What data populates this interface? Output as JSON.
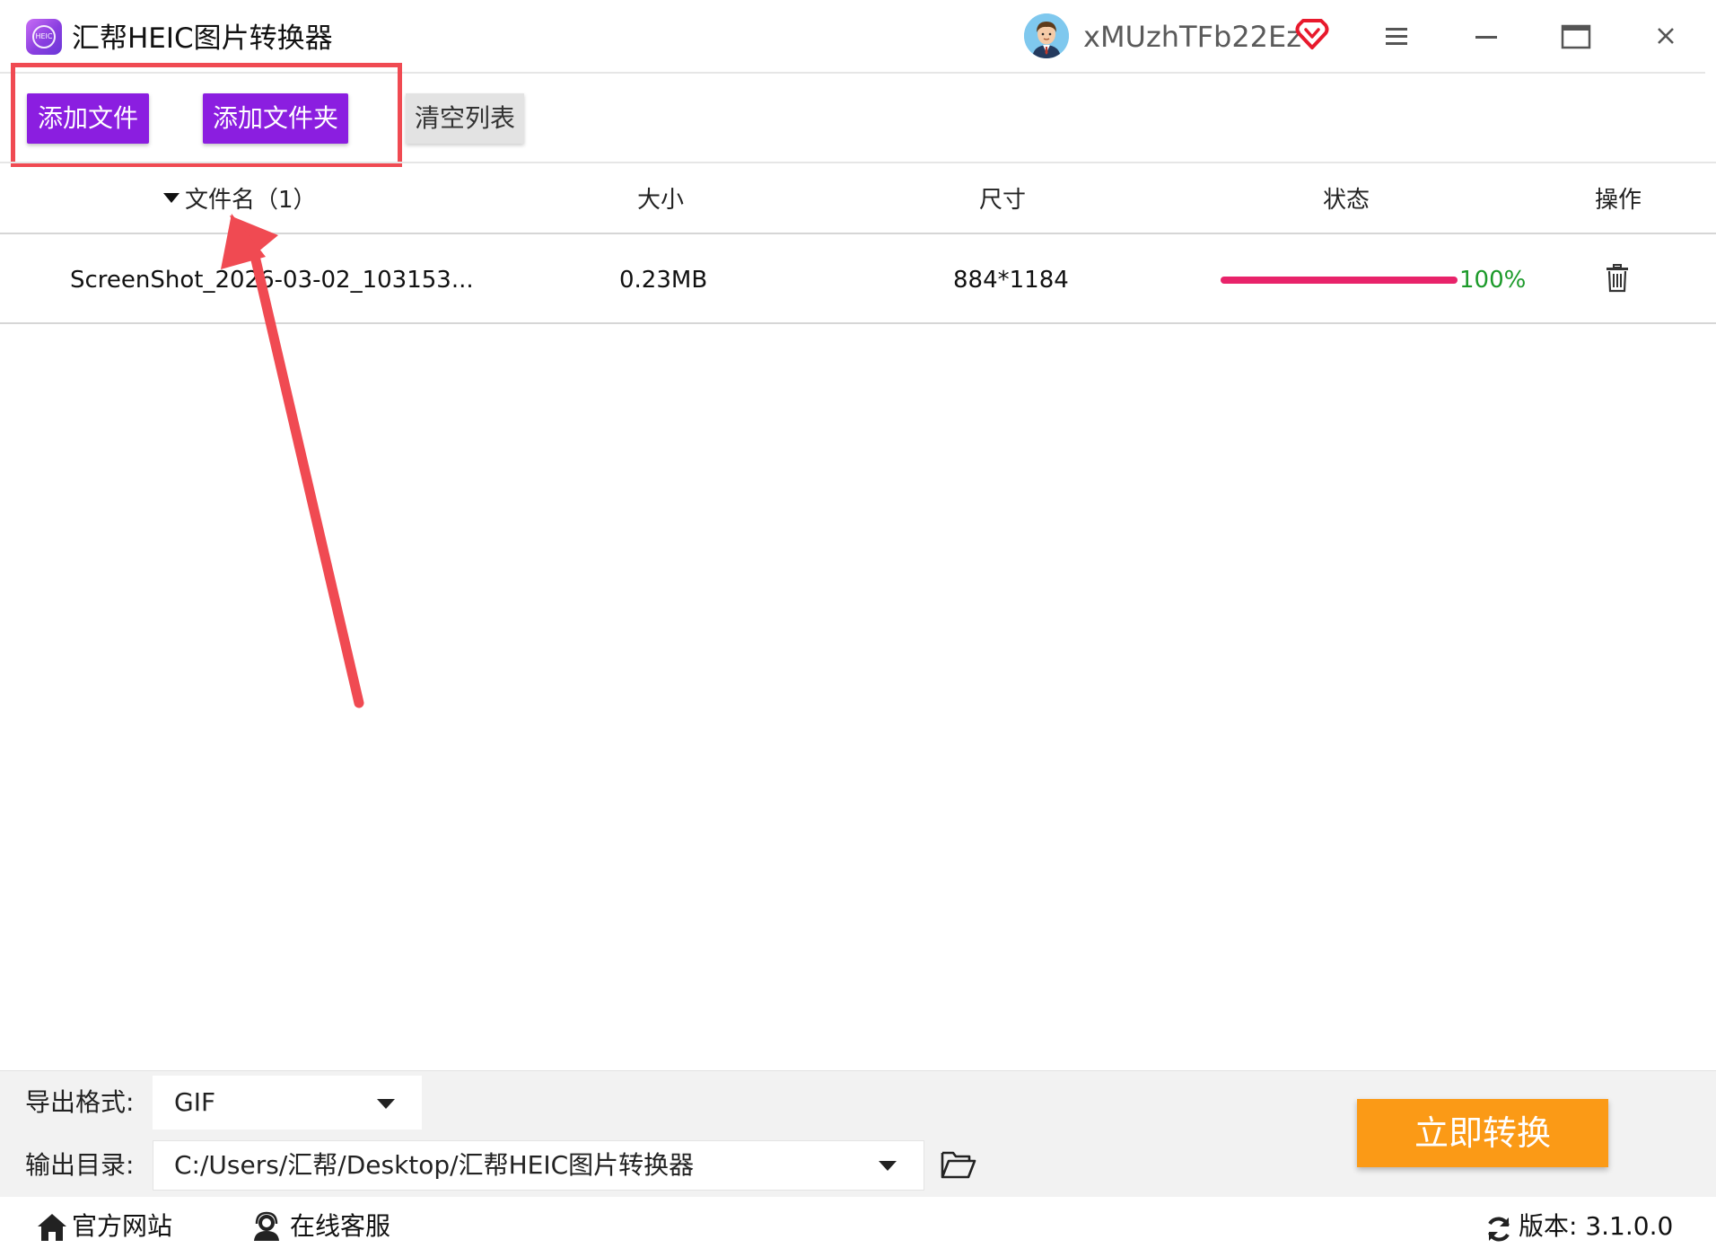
{
  "app": {
    "title": "汇帮HEIC图片转换器",
    "logo_text": "HEIC"
  },
  "user": {
    "name": "xMUzhTFb22Ez"
  },
  "toolbar": {
    "add_file_label": "添加文件",
    "add_folder_label": "添加文件夹",
    "clear_list_label": "清空列表"
  },
  "table": {
    "headers": {
      "name": "文件名（1）",
      "size": "大小",
      "dimensions": "尺寸",
      "status": "状态",
      "actions": "操作"
    },
    "rows": [
      {
        "name": "ScreenShot_2026-03-02_103153...",
        "size": "0.23MB",
        "dimensions": "884*1184",
        "progress_percent": 100,
        "progress_text": "100%"
      }
    ]
  },
  "bottom": {
    "format_label": "导出格式:",
    "format_value": "GIF",
    "dir_label": "输出目录:",
    "dir_value": "C:/Users/汇帮/Desktop/汇帮HEIC图片转换器",
    "convert_label": "立即转换"
  },
  "footer": {
    "website_label": "官方网站",
    "service_label": "在线客服",
    "version_text": "版本: 3.1.0.0"
  },
  "colors": {
    "accent_purple": "#8b1ee0",
    "convert_orange": "#fb9a16",
    "progress_pink": "#e8236a",
    "progress_text_green": "#1c9a2a",
    "annotation_red": "#f04a52"
  },
  "icons": [
    "app-logo",
    "avatar",
    "vip-heart-icon",
    "menu-icon",
    "minimize-icon",
    "maximize-icon",
    "close-icon",
    "sort-triangle-icon",
    "trash-icon",
    "folder-open-icon",
    "home-icon",
    "support-icon",
    "refresh-icon"
  ]
}
